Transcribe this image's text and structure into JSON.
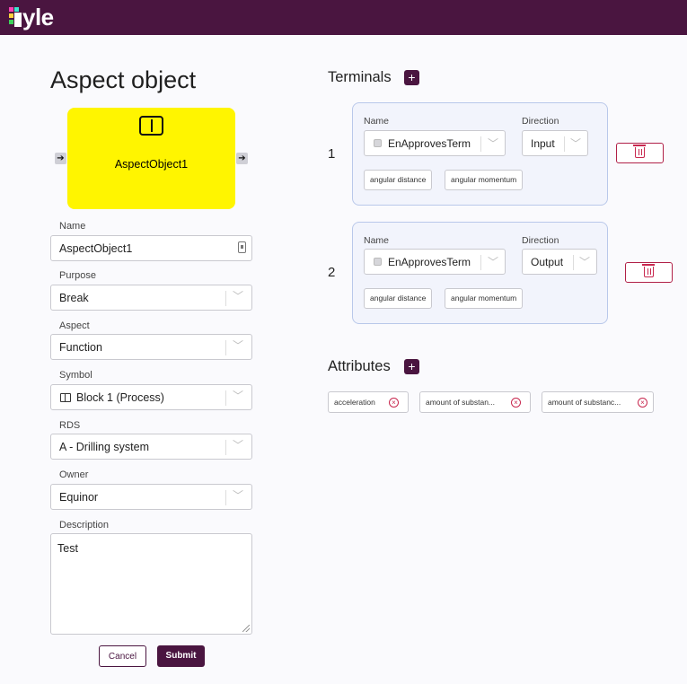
{
  "app": {
    "logo_text": "yle",
    "accent": "#4a1540"
  },
  "form": {
    "title": "Aspect object",
    "node": {
      "label": "AspectObject1",
      "color": "#fff500",
      "symbol_icon": "block-symbol-icon"
    },
    "name": {
      "label": "Name",
      "value": "AspectObject1"
    },
    "purpose": {
      "label": "Purpose",
      "value": "Break"
    },
    "aspect": {
      "label": "Aspect",
      "value": "Function"
    },
    "symbol": {
      "label": "Symbol",
      "value": "Block 1 (Process)"
    },
    "rds": {
      "label": "RDS",
      "value": "A - Drilling system"
    },
    "owner": {
      "label": "Owner",
      "value": "Equinor"
    },
    "description": {
      "label": "Description",
      "value": "Test"
    },
    "cancel_label": "Cancel",
    "submit_label": "Submit"
  },
  "terminals": {
    "title": "Terminals",
    "items": [
      {
        "index": "1",
        "name_label": "Name",
        "name_value": "EnApprovesTerm",
        "direction_label": "Direction",
        "direction_value": "Input",
        "chips": [
          "angular distance",
          "angular momentum"
        ]
      },
      {
        "index": "2",
        "name_label": "Name",
        "name_value": "EnApprovesTerm",
        "direction_label": "Direction",
        "direction_value": "Output",
        "chips": [
          "angular distance",
          "angular momentum"
        ]
      }
    ]
  },
  "attributes": {
    "title": "Attributes",
    "items": [
      "acceleration",
      "amount of substan...",
      "amount of substanc..."
    ]
  }
}
